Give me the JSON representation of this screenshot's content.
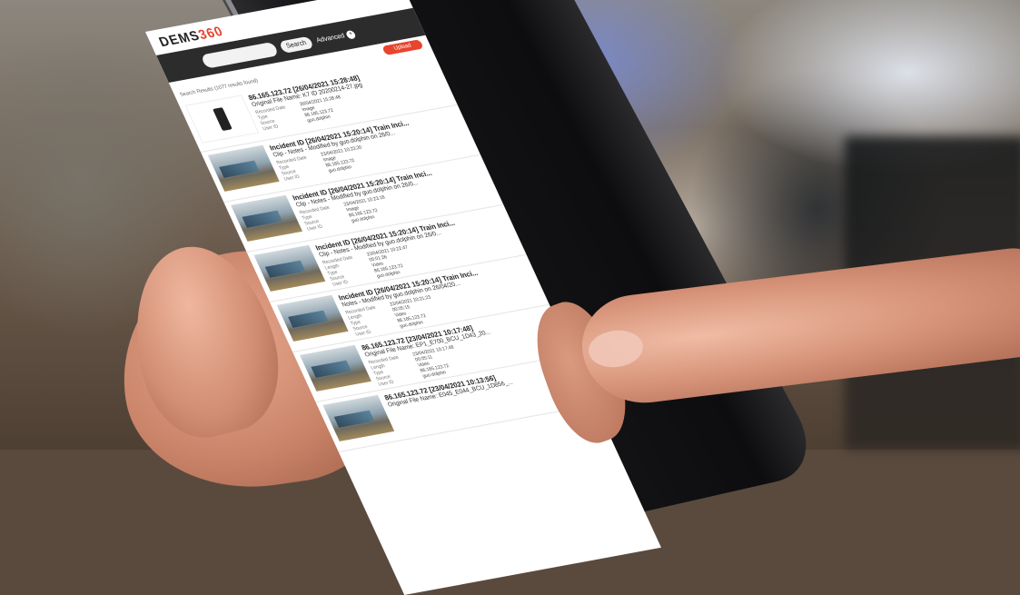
{
  "app": {
    "logo": {
      "prefix": "DEMS",
      "suffix": "360"
    },
    "search": {
      "placeholder": "",
      "button_label": "Search",
      "advanced_label": "Advanced",
      "advanced_icon": "+"
    },
    "results_count": "Search Results (1077 results found)",
    "upload_label": "Upload"
  },
  "results": [
    {
      "thumb": "device",
      "title": "86.165.123.72 [26/04/2021 15:28:48]",
      "subtitle": "Original File Name: K7 ID 20200214-27.jpg",
      "meta": [
        [
          "Recorded Date",
          "26/04/2021 15:28:48"
        ],
        [
          "Type",
          "Image"
        ],
        [
          "Source",
          "86.165.123.72"
        ],
        [
          "User ID",
          "guo.dolphin"
        ]
      ]
    },
    {
      "thumb": "scene",
      "title": "Incident ID [26/04/2021 15:20:14] Train Inci...",
      "subtitle": "Clip - Notes - Modified by guo.dolphin on 26/0...",
      "meta": [
        [
          "Recorded Date",
          "23/04/2021 10:23:20"
        ],
        [
          "Type",
          "Image"
        ],
        [
          "Source",
          "86.165.123.72"
        ],
        [
          "User ID",
          "guo.dolphin"
        ]
      ]
    },
    {
      "thumb": "scene",
      "title": "Incident ID [26/04/2021 15:20:14] Train Inci...",
      "subtitle": "Clip - Notes - Modified by guo.dolphin on 26/0...",
      "meta": [
        [
          "Recorded Date",
          "23/04/2021 10:23:18"
        ],
        [
          "Type",
          "Image"
        ],
        [
          "Source",
          "86.165.123.72"
        ],
        [
          "User ID",
          "guo.dolphin"
        ]
      ]
    },
    {
      "thumb": "scene",
      "title": "Incident ID [26/04/2021 15:20:14] Train Inci...",
      "subtitle": "Clip - Notes - Modified by guo.dolphin on 26/0...",
      "meta": [
        [
          "Recorded Date",
          "23/04/2021 10:22:47"
        ],
        [
          "Length",
          "00:01:26"
        ],
        [
          "Type",
          "Video"
        ],
        [
          "Source",
          "86.165.123.72"
        ],
        [
          "User ID",
          "guo.dolphin"
        ]
      ]
    },
    {
      "thumb": "scene",
      "title": "Incident ID [26/04/2021 15:20:14] Train Inci...",
      "subtitle": "Notes - Modified by guo.dolphin on 26/04/20...",
      "meta": [
        [
          "Recorded Date",
          "23/04/2021 10:21:23"
        ],
        [
          "Length",
          "00:05:15"
        ],
        [
          "Type",
          "Video"
        ],
        [
          "Source",
          "86.165.123.72"
        ],
        [
          "User ID",
          "guo.dolphin"
        ]
      ]
    },
    {
      "thumb": "scene",
      "title": "86.165.123.72 [23/04/2021 10:17:48]",
      "subtitle": "Original File Name: EP1_E700_BCU_1D43_20...",
      "meta": [
        [
          "Recorded Date",
          "23/04/2021 10:17:48"
        ],
        [
          "Length",
          "00:05:11"
        ],
        [
          "Type",
          "Video"
        ],
        [
          "Source",
          "86.165.123.72"
        ],
        [
          "User ID",
          "guo.dolphin"
        ]
      ]
    },
    {
      "thumb": "scene",
      "title": "86.165.123.72 [23/04/2021 10:13:56]",
      "subtitle": "Original File Name: E045_E044_BCU_1D856_...",
      "meta": []
    }
  ]
}
